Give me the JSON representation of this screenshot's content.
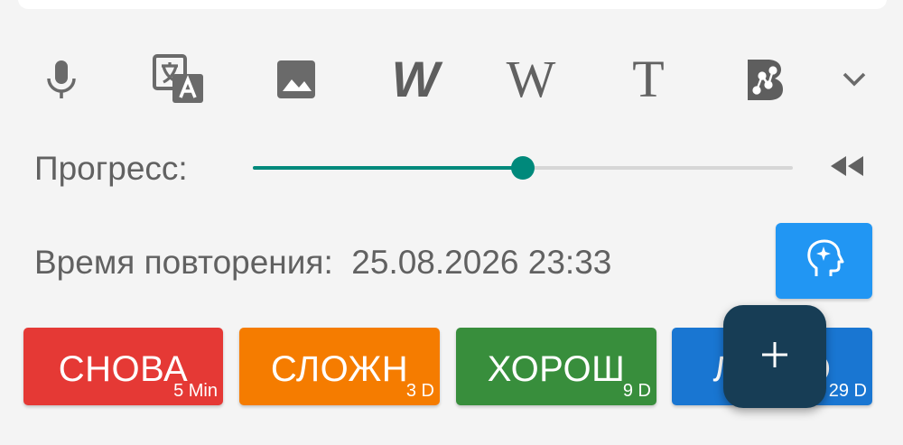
{
  "toolbar": {
    "items": [
      {
        "icon": "microphone-icon"
      },
      {
        "icon": "translate-icon"
      },
      {
        "icon": "image-icon"
      },
      {
        "icon": "wiktionary-icon",
        "glyph": "W"
      },
      {
        "icon": "wikipedia-icon",
        "glyph": "W"
      },
      {
        "icon": "text-icon",
        "glyph": "T"
      },
      {
        "icon": "b-network-icon"
      },
      {
        "icon": "chevron-down-icon"
      }
    ]
  },
  "progress": {
    "label": "Прогресс:",
    "value": 0.5
  },
  "review": {
    "label": "Время повторения:",
    "datetime": "25.08.2026 23:33"
  },
  "answers": [
    {
      "label": "СНОВА",
      "interval": "5 Min",
      "color": "#e53935"
    },
    {
      "label": "СЛОЖН",
      "interval": "3 D",
      "color": "#f57c00"
    },
    {
      "label": "ХОРОШ",
      "interval": "9 D",
      "color": "#388e3c"
    },
    {
      "label": "ЛЕГКО",
      "interval": "29 D",
      "color": "#1976d2"
    }
  ],
  "colors": {
    "accent": "#00897b",
    "brain_button": "#2196f3",
    "fab": "#173d55",
    "text": "#616161"
  }
}
